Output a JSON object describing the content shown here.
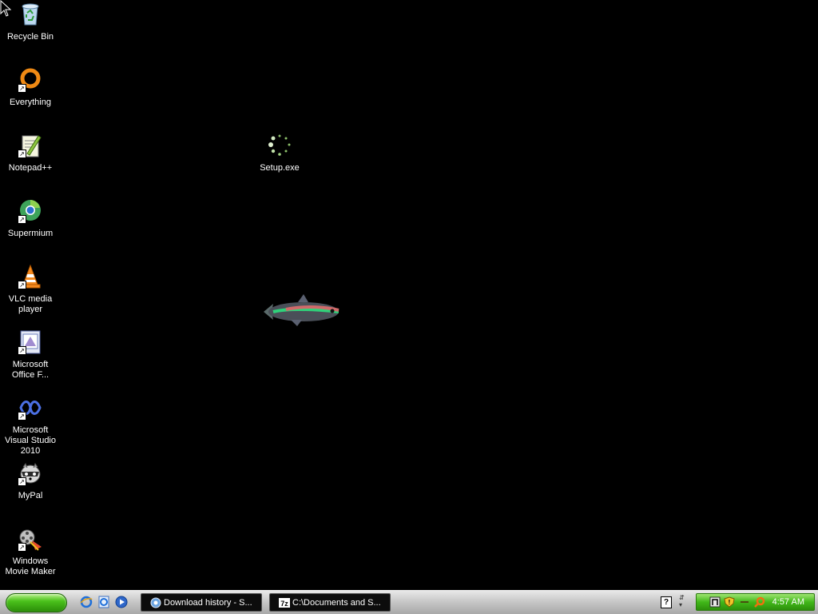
{
  "desktop": {
    "icons": [
      {
        "label": "Recycle Bin",
        "icon": "recycle-bin-icon"
      },
      {
        "label": "Everything",
        "icon": "everything-search-icon"
      },
      {
        "label": "Notepad++",
        "icon": "notepad-plus-plus-icon"
      },
      {
        "label": "Supermium",
        "icon": "supermium-browser-icon"
      },
      {
        "label": "VLC media player",
        "icon": "vlc-cone-icon"
      },
      {
        "label": "Microsoft Office F...",
        "icon": "office-file-icon"
      },
      {
        "label": "Microsoft Visual Studio 2010",
        "icon": "visual-studio-icon"
      },
      {
        "label": "MyPal",
        "icon": "mypal-raccoon-icon"
      },
      {
        "label": "Windows Movie Maker",
        "icon": "movie-maker-icon"
      },
      {
        "label": "Setup.exe",
        "icon": "loading-spinner-icon"
      }
    ]
  },
  "taskbar": {
    "start_icon": "start-button",
    "quick_launch": [
      "internet-explorer-icon",
      "ie-page-icon",
      "media-player-icon"
    ],
    "tasks": [
      {
        "label": "Download history - S...",
        "icon": "browser-icon"
      },
      {
        "label": "C:\\Documents and S...",
        "icon": "7zip-icon"
      }
    ],
    "language_indicator": "?",
    "tray_icons": [
      "network-icon",
      "security-shield-icon",
      "arrow-icon",
      "search-tray-icon"
    ],
    "clock": "4:57 AM"
  },
  "colors": {
    "desktop_bg": "#000000",
    "taskbar_bg": "#c8c8c8",
    "start_green": "#4bc21c",
    "tray_green": "#41b81a"
  }
}
